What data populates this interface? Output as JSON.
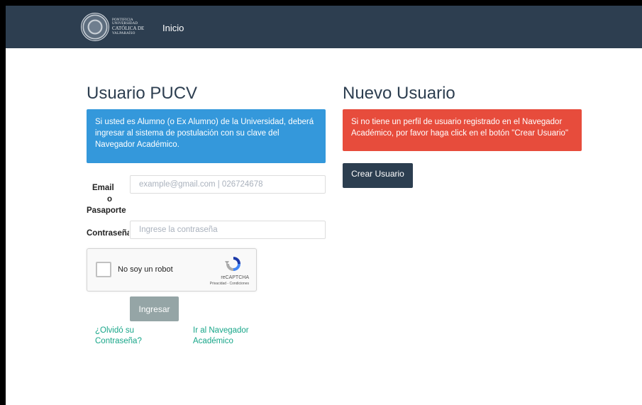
{
  "navbar": {
    "logo": {
      "line1": "PONTIFICIA",
      "line2": "UNIVERSIDAD",
      "line3": "CATÓLICA DE",
      "line4": "VALPARAÍSO"
    },
    "inicio_label": "Inicio"
  },
  "login": {
    "title": "Usuario PUCV",
    "info": "Si usted es Alumno (o Ex Alumno) de la Universidad, deberá ingresar al sistema de postulación con su clave del Navegador Académico.",
    "email_label_1": "Email",
    "email_label_2": "o",
    "email_label_3": "Pasaporte",
    "email_value": "",
    "email_placeholder": "example@gmail.com | 026724678",
    "password_label": "Contraseña",
    "password_value": "",
    "password_placeholder": "Ingrese la contraseña",
    "submit_label": "Ingresar",
    "forgot_link": "¿Olvidó su Contraseña?",
    "navegador_link": "Ir al Navegador Académico"
  },
  "recaptcha": {
    "label": "No soy un robot",
    "brand": "reCAPTCHA",
    "terms": "Privacidad - Condiciones"
  },
  "new_user": {
    "title": "Nuevo Usuario",
    "info": "Si no tiene un perfil de usuario registrado en el Navegador Académico, por favor haga click en el botón \"Crear Usuario\"",
    "button_label": "Crear Usuario"
  },
  "colors": {
    "navbar": "#2d3e50",
    "info_blue": "#3498db",
    "alert_red": "#e74c3c",
    "link_green": "#18a689",
    "button_gray": "#95a5a6"
  }
}
